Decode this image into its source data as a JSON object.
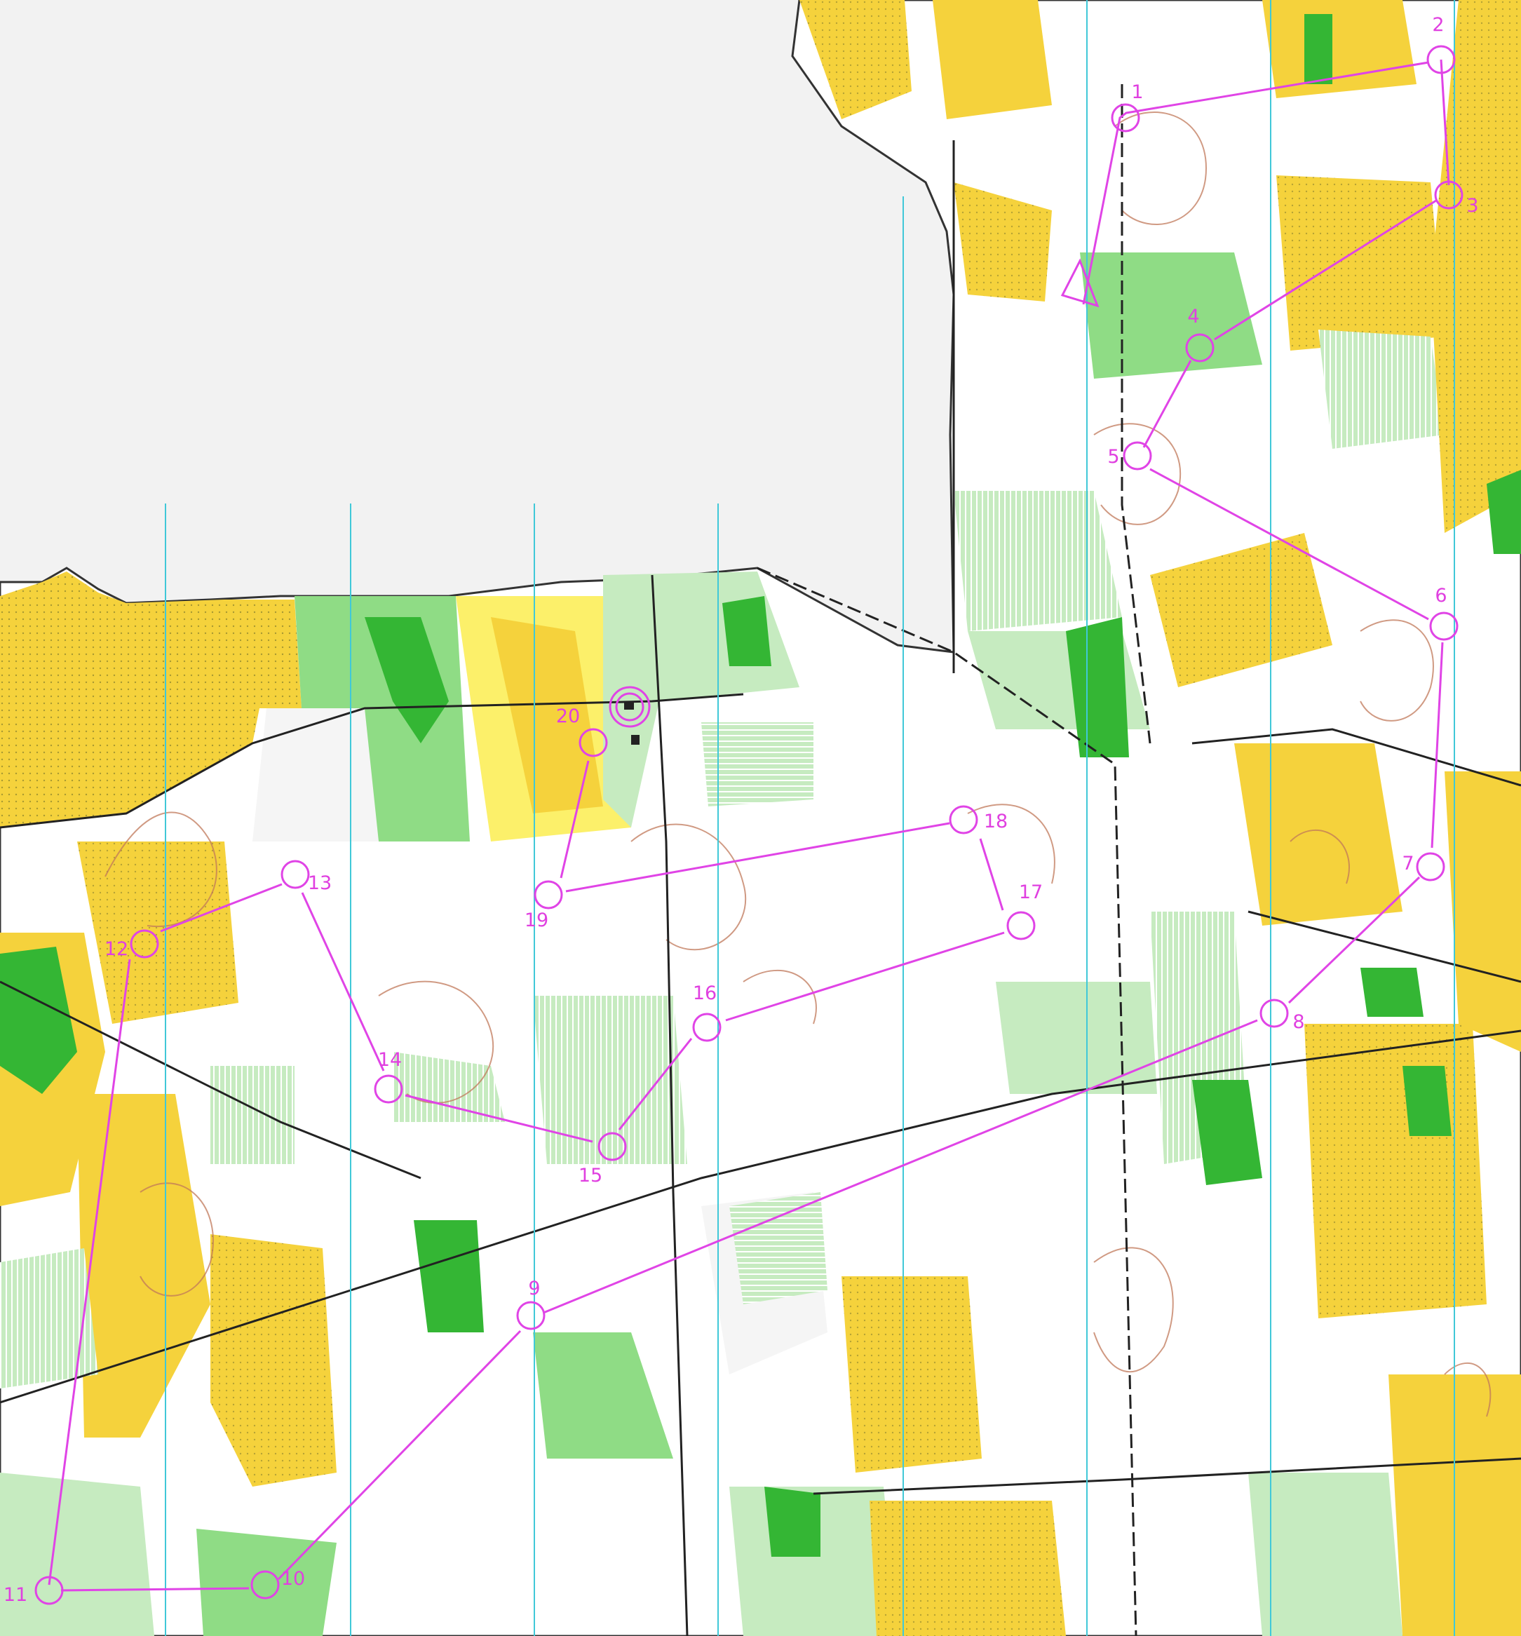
{
  "map": {
    "colors": {
      "background": "#f2f2f2",
      "open_land": "#fcf06a",
      "yellow": "#f5d23c",
      "rough_open": "#fffaa0",
      "green_light": "#c6ebc0",
      "green_mid": "#8fdc85",
      "green_dark": "#34b634",
      "forest_white": "#f5f5f5",
      "contour": "#c0785a",
      "course": "#e044e6",
      "magnetic_north_line": "#40c8d8",
      "track": "#222222"
    },
    "course": {
      "start_icon": "start-triangle-icon",
      "finish_icon": "finish-double-circle-icon",
      "controls": [
        {
          "label": "1"
        },
        {
          "label": "2"
        },
        {
          "label": "3"
        },
        {
          "label": "4"
        },
        {
          "label": "5"
        },
        {
          "label": "6"
        },
        {
          "label": "7"
        },
        {
          "label": "8"
        },
        {
          "label": "9"
        },
        {
          "label": "10"
        },
        {
          "label": "11"
        },
        {
          "label": "12"
        },
        {
          "label": "13"
        },
        {
          "label": "14"
        },
        {
          "label": "15"
        },
        {
          "label": "16"
        },
        {
          "label": "17"
        },
        {
          "label": "18"
        },
        {
          "label": "19"
        },
        {
          "label": "20"
        }
      ]
    }
  }
}
